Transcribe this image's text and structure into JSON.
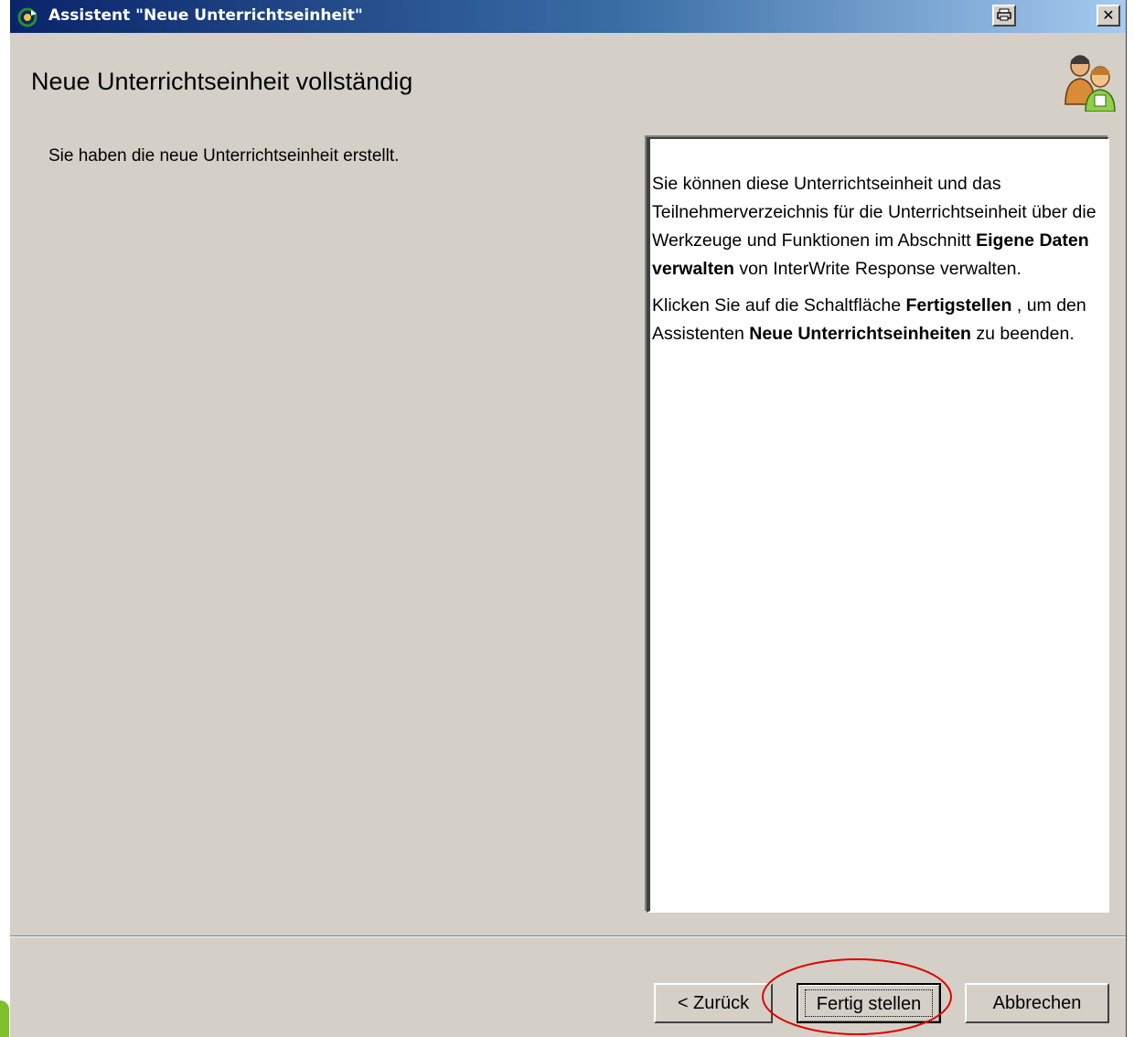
{
  "window": {
    "title": "Assistent \"Neue Unterrichtseinheit\"",
    "print_icon": "print-icon",
    "close_label": "✕"
  },
  "page": {
    "title": "Neue Unterrichtseinheit vollständig",
    "intro": "Sie haben die neue Unterrichtseinheit erstellt."
  },
  "info": {
    "p1_part1": "Sie können diese Unterrichtseinheit und das Teilnehmerverzeichnis für die Unterrichtseinheit über die Werkzeuge und Funktionen im Abschnitt ",
    "p1_bold": "Eigene Daten verwalten",
    "p1_part2": " von InterWrite Response verwalten.",
    "p2_part1": "Klicken Sie auf die Schaltfläche ",
    "p2_bold1": "Fertigstellen",
    "p2_part2": " , um den Assistenten ",
    "p2_bold2": "Neue Unterrichtseinheiten",
    "p2_part3": " zu beenden."
  },
  "buttons": {
    "back": "< Zurück",
    "finish": "Fertig stellen",
    "cancel": "Abbrechen"
  },
  "colors": {
    "annotation": "#e00000",
    "title_gradient_start": "#0a246a",
    "dialog_bg": "#d4d0c8"
  }
}
